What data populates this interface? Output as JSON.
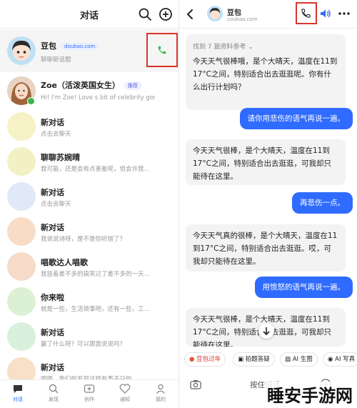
{
  "left": {
    "title": "对话",
    "conversations": [
      {
        "name": "豆包",
        "badge": "doubao.com",
        "subtitle": "聊聊新话题"
      },
      {
        "name": "Zoe（活泼英国女生）",
        "badge": "推荐",
        "subtitle": "Hi! I'm Zoe! Love s bit of celebrity goss..."
      },
      {
        "name": "新对话",
        "subtitle": "点击去聊天"
      },
      {
        "name": "聊聊苏婉晴",
        "subtitle": "我可能，还是会有点害羞呢，但会许我..."
      },
      {
        "name": "新对话",
        "subtitle": "点击去聊天"
      },
      {
        "name": "新对话",
        "subtitle": "我说说诗呀，是不是你听错了？"
      },
      {
        "name": "唱歌达人唱歌",
        "subtitle": "我挂着差不多的搞笑过了差不多的一天..."
      },
      {
        "name": "你来啦",
        "subtitle": "就是一些，生活琐事吧，还有一些，工..."
      },
      {
        "name": "新对话",
        "subtitle": "赢了什么呀？可以跟我说说吗？"
      },
      {
        "name": "新对话",
        "subtitle": "嗯嗯，我们的发现这样有事不只的..."
      }
    ],
    "tabs": [
      "对话",
      "发现",
      "创作",
      "通知",
      "我的"
    ]
  },
  "right": {
    "bot_name": "豆包",
    "bot_domain": "coubao.com",
    "reference": "找到 7 篇资料参考 ⌄",
    "messages": [
      {
        "role": "bot",
        "text": "今天天气很棒哦，是个大晴天，温度在11到17°C之间，特别适合出去逛逛呢。你有什么出行计划吗？"
      },
      {
        "role": "user",
        "text": "请你用悲伤的语气再说一遍。"
      },
      {
        "role": "bot",
        "text": "今天天气很棒，是个大晴天，温度在11到17°C之间，特别适合出去逛逛，可我却只能待在这里。"
      },
      {
        "role": "user",
        "text": "再悲伤一点。"
      },
      {
        "role": "bot",
        "text": "今天天气真的很棒，是个大晴天，温度在11到17°C之间，特别适合出去逛逛。哎，可我却只能待在这里。"
      },
      {
        "role": "user",
        "text": "用愤怒的语气再说一遍。"
      },
      {
        "role": "bot",
        "text": "今天天气很棒，是个大晴天，温度在11到17°C之间，特别适合出去逛逛，可我却只能待在这里。"
      }
    ],
    "chips": [
      "豆包过年",
      "拍题答疑",
      "AI 生图",
      "AI 写真"
    ],
    "input_placeholder": "按住说话"
  },
  "watermark": "睡安手游网",
  "colors": {
    "accent": "#2f6bff",
    "highlight": "#d9342b",
    "call_green": "#3bb54a"
  }
}
